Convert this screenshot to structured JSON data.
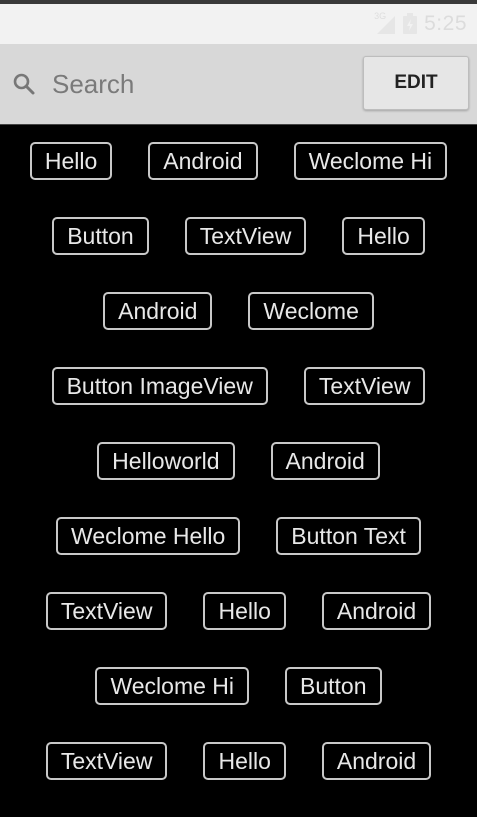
{
  "status_bar": {
    "network": "3G",
    "time": "5:25"
  },
  "search": {
    "placeholder": "Search",
    "value": "",
    "edit_label": "EDIT"
  },
  "tag_rows": [
    [
      "Hello",
      "Android",
      "Weclome Hi"
    ],
    [
      "Button",
      "TextView",
      "Hello"
    ],
    [
      "Android",
      "Weclome"
    ],
    [
      "Button ImageView",
      "TextView"
    ],
    [
      "Helloworld",
      "Android"
    ],
    [
      "Weclome Hello",
      "Button Text"
    ],
    [
      "TextView",
      "Hello",
      "Android"
    ],
    [
      "Weclome Hi",
      "Button"
    ],
    [
      "TextView",
      "Hello",
      "Android"
    ]
  ],
  "colors": {
    "background": "#000000",
    "status_bar": "#f2f2f2",
    "search_bar": "#d8d8d8",
    "tag_border": "#c8c8c8",
    "tag_text": "#e8e8e8"
  },
  "icons": [
    "search-icon",
    "signal-icon",
    "battery-icon"
  ]
}
